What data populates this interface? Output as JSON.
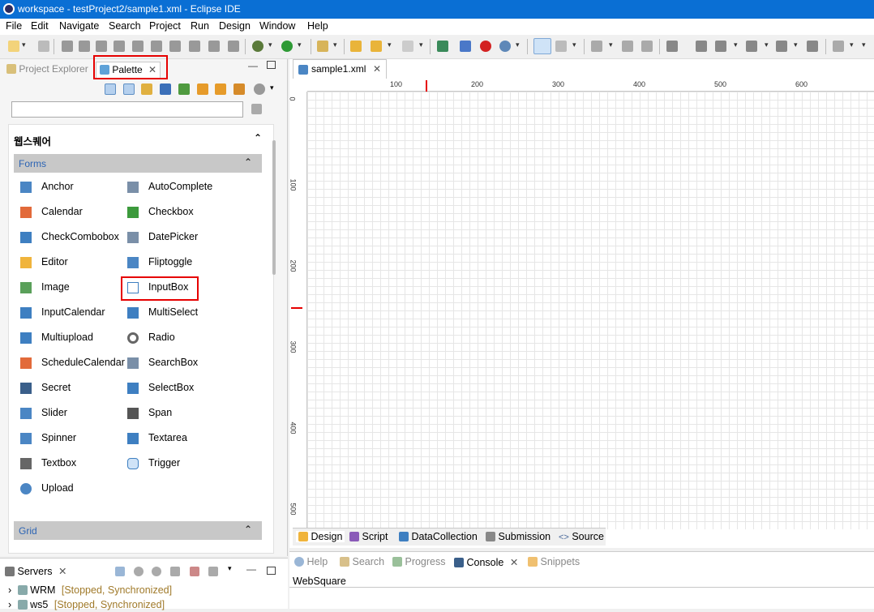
{
  "window": {
    "title": "workspace - testProject2/sample1.xml - Eclipse IDE"
  },
  "menu": [
    "File",
    "Edit",
    "Navigate",
    "Search",
    "Project",
    "Run",
    "Design",
    "Window",
    "Help"
  ],
  "left_tabs": {
    "project_explorer": "Project Explorer",
    "palette": "Palette"
  },
  "palette": {
    "filter_placeholder": "",
    "drawer_title": "웹스퀘어",
    "category_forms": "Forms",
    "category_grid": "Grid",
    "items_left": [
      "Anchor",
      "Calendar",
      "CheckCombobox",
      "Editor",
      "Image",
      "InputCalendar",
      "Multiupload",
      "ScheduleCalendar",
      "Secret",
      "Slider",
      "Spinner",
      "Textbox",
      "Upload"
    ],
    "items_right": [
      "AutoComplete",
      "Checkbox",
      "DatePicker",
      "Fliptoggle",
      "InputBox",
      "MultiSelect",
      "Radio",
      "SearchBox",
      "SelectBox",
      "Span",
      "Textarea",
      "Trigger"
    ]
  },
  "editor": {
    "tab_label": "sample1.xml",
    "ruler_top": [
      "100",
      "200",
      "300",
      "400",
      "500",
      "600"
    ],
    "ruler_left": [
      "0",
      "100",
      "200",
      "300",
      "400",
      "500"
    ],
    "bottom_tabs": [
      "Design",
      "Script",
      "DataCollection",
      "Submission",
      "Source"
    ]
  },
  "servers": {
    "tab_label": "Servers",
    "rows": [
      {
        "name": "WRM",
        "status": "[Stopped, Synchronized]"
      },
      {
        "name": "ws5",
        "status": "[Stopped, Synchronized]"
      }
    ]
  },
  "console_area": {
    "tabs": [
      "Help",
      "Search",
      "Progress",
      "Console",
      "Snippets"
    ],
    "text": "WebSquare"
  },
  "colors": {
    "accent": "#0a6fd4",
    "highlight": "#e60000",
    "category_text": "#2c64b4"
  }
}
